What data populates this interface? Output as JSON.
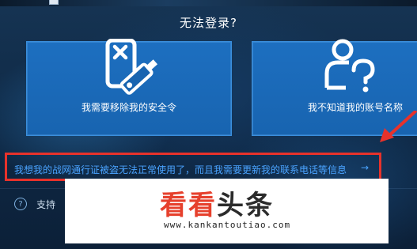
{
  "dialog": {
    "title": "无法登录?"
  },
  "options": [
    {
      "label": "我需要移除我的安全令",
      "icon": "authenticator-remove-icon"
    },
    {
      "label": "我不知道我的账号名称",
      "icon": "unknown-account-icon"
    }
  ],
  "link": {
    "text": "我想我的战网通行证被盗无法正常使用了，而且我需要更新我的联系电话等信息",
    "arrow": "→"
  },
  "support": {
    "label": "支持"
  },
  "watermark": {
    "cn_part1": "看看",
    "cn_part2": "头条",
    "url": "www.kankantoutiao.com"
  },
  "colors": {
    "card_blue": "#1864b0",
    "link_blue": "#4aa3ff",
    "highlight_red": "#e8322b"
  }
}
